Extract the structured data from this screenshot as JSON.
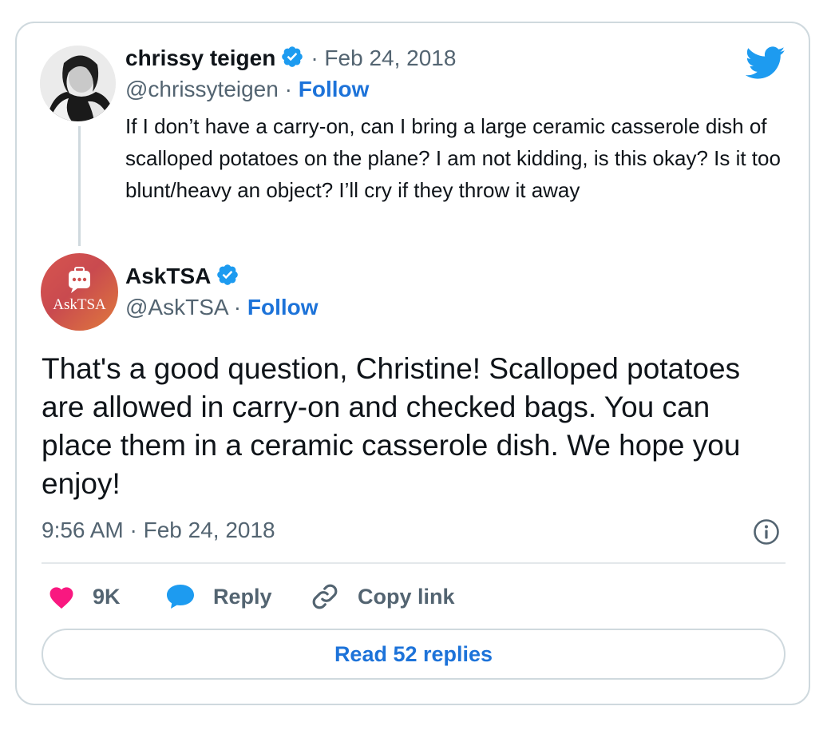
{
  "quoted_tweet": {
    "author_name": "chrissy teigen",
    "date": "· Feb 24, 2018",
    "handle": "@chrissyteigen",
    "follow_label": "Follow",
    "text": "If I don’t have a carry-on, can I bring a large ceramic casserole dish of scalloped potatoes on the plane? I am not kidding, is this okay? Is it too blunt/heavy an object? I’ll cry if they throw it away"
  },
  "reply_tweet": {
    "author_name": "AskTSA",
    "handle": "@AskTSA",
    "follow_label": "Follow",
    "avatar_text": "AskTSA",
    "text": "That's a good question, Christine! Scalloped potatoes are allowed in carry-on and checked bags. You can place them in a ceramic casserole dish. We hope you enjoy!",
    "timestamp": "9:56 AM · Feb 24, 2018"
  },
  "actions": {
    "like_count": "9K",
    "reply_label": "Reply",
    "copy_link_label": "Copy link"
  },
  "read_replies_label": "Read 52 replies",
  "colors": {
    "accent": "#1d73d9",
    "twitter_blue": "#1d9bf0",
    "heart": "#f91880",
    "secondary_text": "#536471",
    "border": "#cfd9de"
  },
  "icons": [
    "twitter-bird-icon",
    "verified-badge-icon",
    "info-icon",
    "heart-icon",
    "reply-bubble-icon",
    "link-icon"
  ]
}
